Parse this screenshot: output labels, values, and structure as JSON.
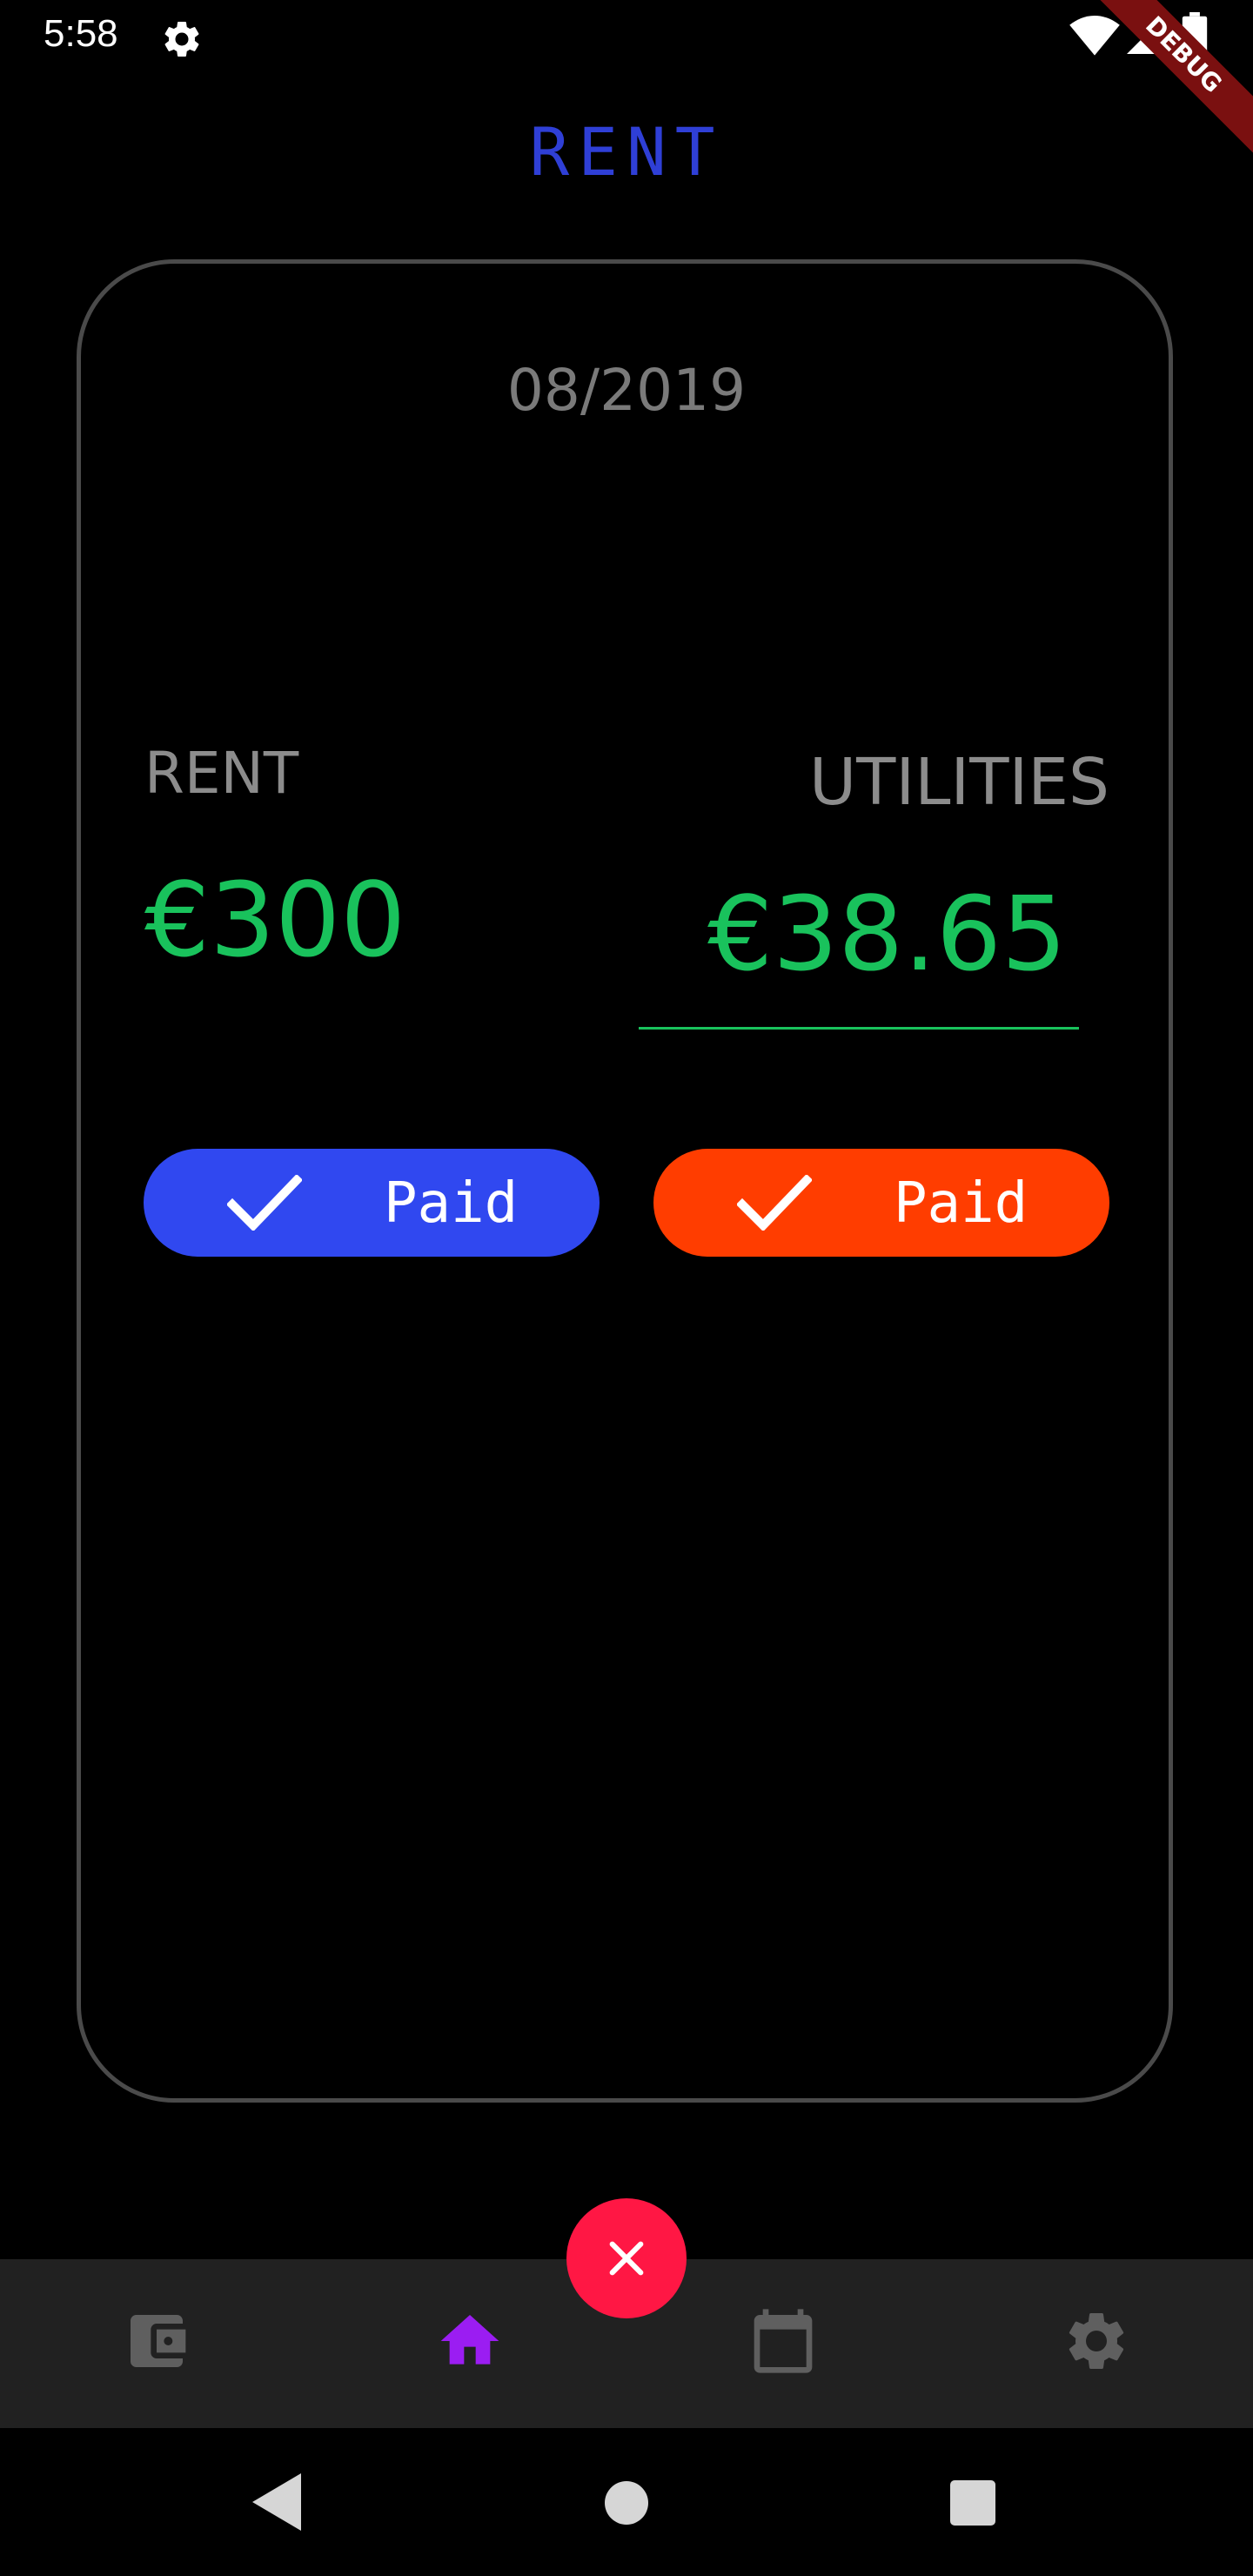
{
  "status_bar": {
    "time": "5:58",
    "debug_label": "DEBUG"
  },
  "app": {
    "title": "RENT"
  },
  "card": {
    "date": "08/2019",
    "rent": {
      "label": "RENT",
      "amount": "€300",
      "status_label": "Paid",
      "status_color": "#3048f0"
    },
    "utilities": {
      "label": "UTILITIES",
      "amount": "€38.65",
      "status_label": "Paid",
      "status_color": "#ff3d00"
    }
  },
  "bottom_nav": {
    "items": [
      {
        "icon": "wallet-icon",
        "selected": false
      },
      {
        "icon": "home-icon",
        "selected": true
      },
      {
        "icon": "calendar-icon",
        "selected": false
      },
      {
        "icon": "settings-icon",
        "selected": false
      }
    ],
    "fab_icon": "close-icon",
    "accent_color": "#9b1df2"
  },
  "colors": {
    "amount_green": "#19c25c",
    "title_blue": "#2f3fd6",
    "fab_red": "#ff1744"
  }
}
